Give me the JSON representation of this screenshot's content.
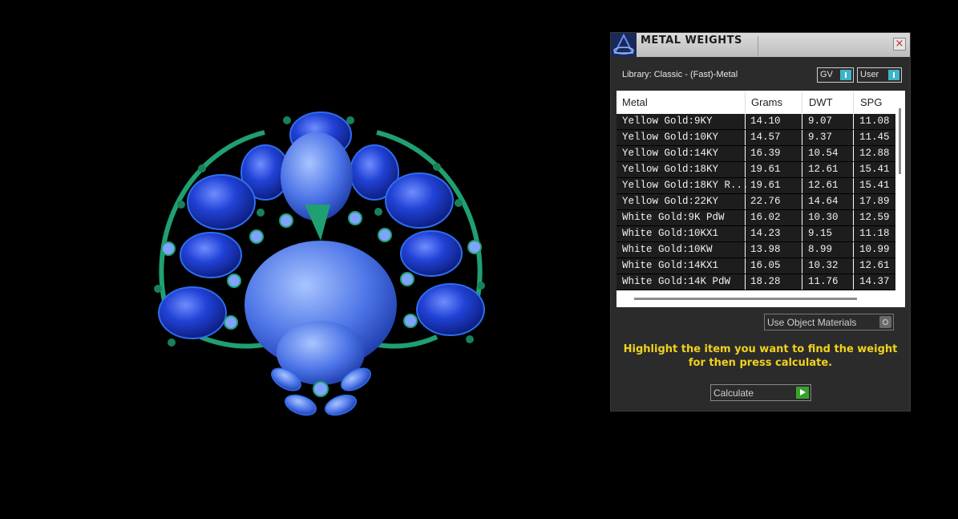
{
  "viewport": {
    "model_name": "peacock-brooch-render"
  },
  "panel": {
    "title": "METAL WEIGHTS",
    "close_symbol": "×",
    "library_label": "Library: Classic - (Fast)-Metal",
    "toggles": {
      "gv": "GV",
      "user": "User"
    },
    "table": {
      "columns": [
        "Metal",
        "Grams",
        "DWT",
        "SPG"
      ],
      "rows": [
        [
          "Yellow Gold:9KY",
          "14.10",
          "9.07",
          "11.08"
        ],
        [
          "Yellow Gold:10KY",
          "14.57",
          "9.37",
          "11.45"
        ],
        [
          "Yellow Gold:14KY",
          "16.39",
          "10.54",
          "12.88"
        ],
        [
          "Yellow Gold:18KY",
          "19.61",
          "12.61",
          "15.41"
        ],
        [
          "Yellow Gold:18KY R...",
          "19.61",
          "12.61",
          "15.41"
        ],
        [
          "Yellow Gold:22KY",
          "22.76",
          "14.64",
          "17.89"
        ],
        [
          "White Gold:9K PdW",
          "16.02",
          "10.30",
          "12.59"
        ],
        [
          "White Gold:10KX1",
          "14.23",
          "9.15",
          "11.18"
        ],
        [
          "White Gold:10KW",
          "13.98",
          "8.99",
          "10.99"
        ],
        [
          "White Gold:14KX1",
          "16.05",
          "10.32",
          "12.61"
        ],
        [
          "White Gold:14K PdW",
          "18.28",
          "11.76",
          "14.37"
        ]
      ]
    },
    "use_object_materials": "Use Object Materials",
    "hint_line1": "Highlight the item you want to find the weight",
    "hint_line2": "for then press calculate.",
    "calculate_label": "Calculate",
    "colors": {
      "hint": "#f1d21c",
      "toggle_knob": "#3fb4c4",
      "play": "#38a12b",
      "gem_blue": "#1f3fc8",
      "metal_green": "#1fa070"
    }
  }
}
